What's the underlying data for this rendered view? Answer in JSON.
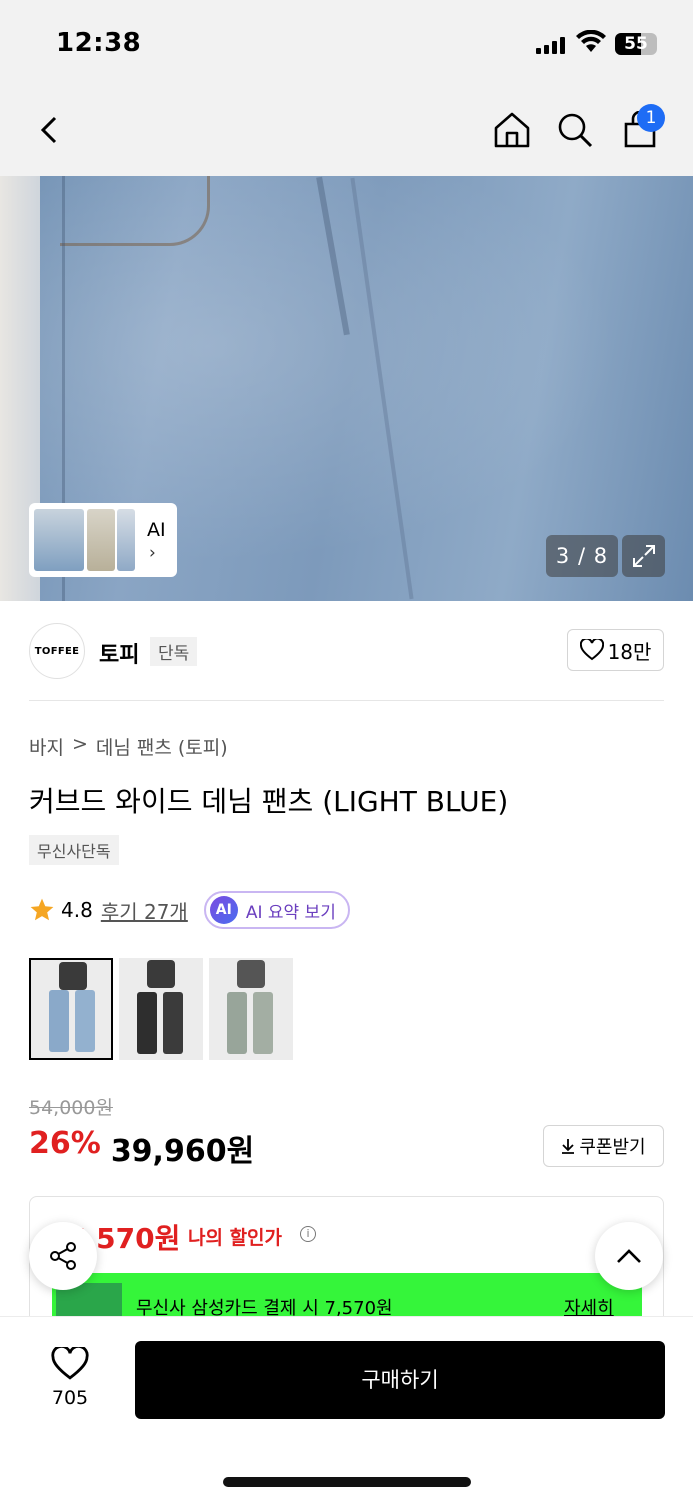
{
  "status_bar": {
    "time": "12:38",
    "battery": "55"
  },
  "nav": {
    "cart_count": "1"
  },
  "gallery": {
    "thumb_label": "AI",
    "counter": "3 / 8"
  },
  "brand": {
    "logo_text": "TOFFEE",
    "name": "토피",
    "tag": "단독",
    "like_count": "18만"
  },
  "product": {
    "breadcrumb": [
      "바지",
      ">",
      "데님 팬츠 (토피)"
    ],
    "title": "커브드 와이드 데님 팬츠 (LIGHT BLUE)",
    "exclusive_badge": "무신사단독",
    "rating": "4.8",
    "review_link": "후기 27개",
    "ai_badge": "AI",
    "ai_summary": "AI 요약 보기",
    "color_options": [
      "light blue",
      "black",
      "green gray"
    ]
  },
  "price": {
    "original": "54,000원",
    "discount_rate": "26%",
    "sale": "39,960원",
    "coupon_button": "쿠폰받기"
  },
  "my_discount": {
    "amount": "7,570원",
    "label": "나의 할인가",
    "card_text": "무신사 삼성카드 결제 시 7,570원",
    "card_more": "자세히"
  },
  "bottom": {
    "wish_count": "705",
    "buy_label": "구매하기"
  },
  "colors": {
    "accent_red": "#e02020",
    "badge_blue": "#1e6cf5",
    "card_green": "#35f53a"
  }
}
